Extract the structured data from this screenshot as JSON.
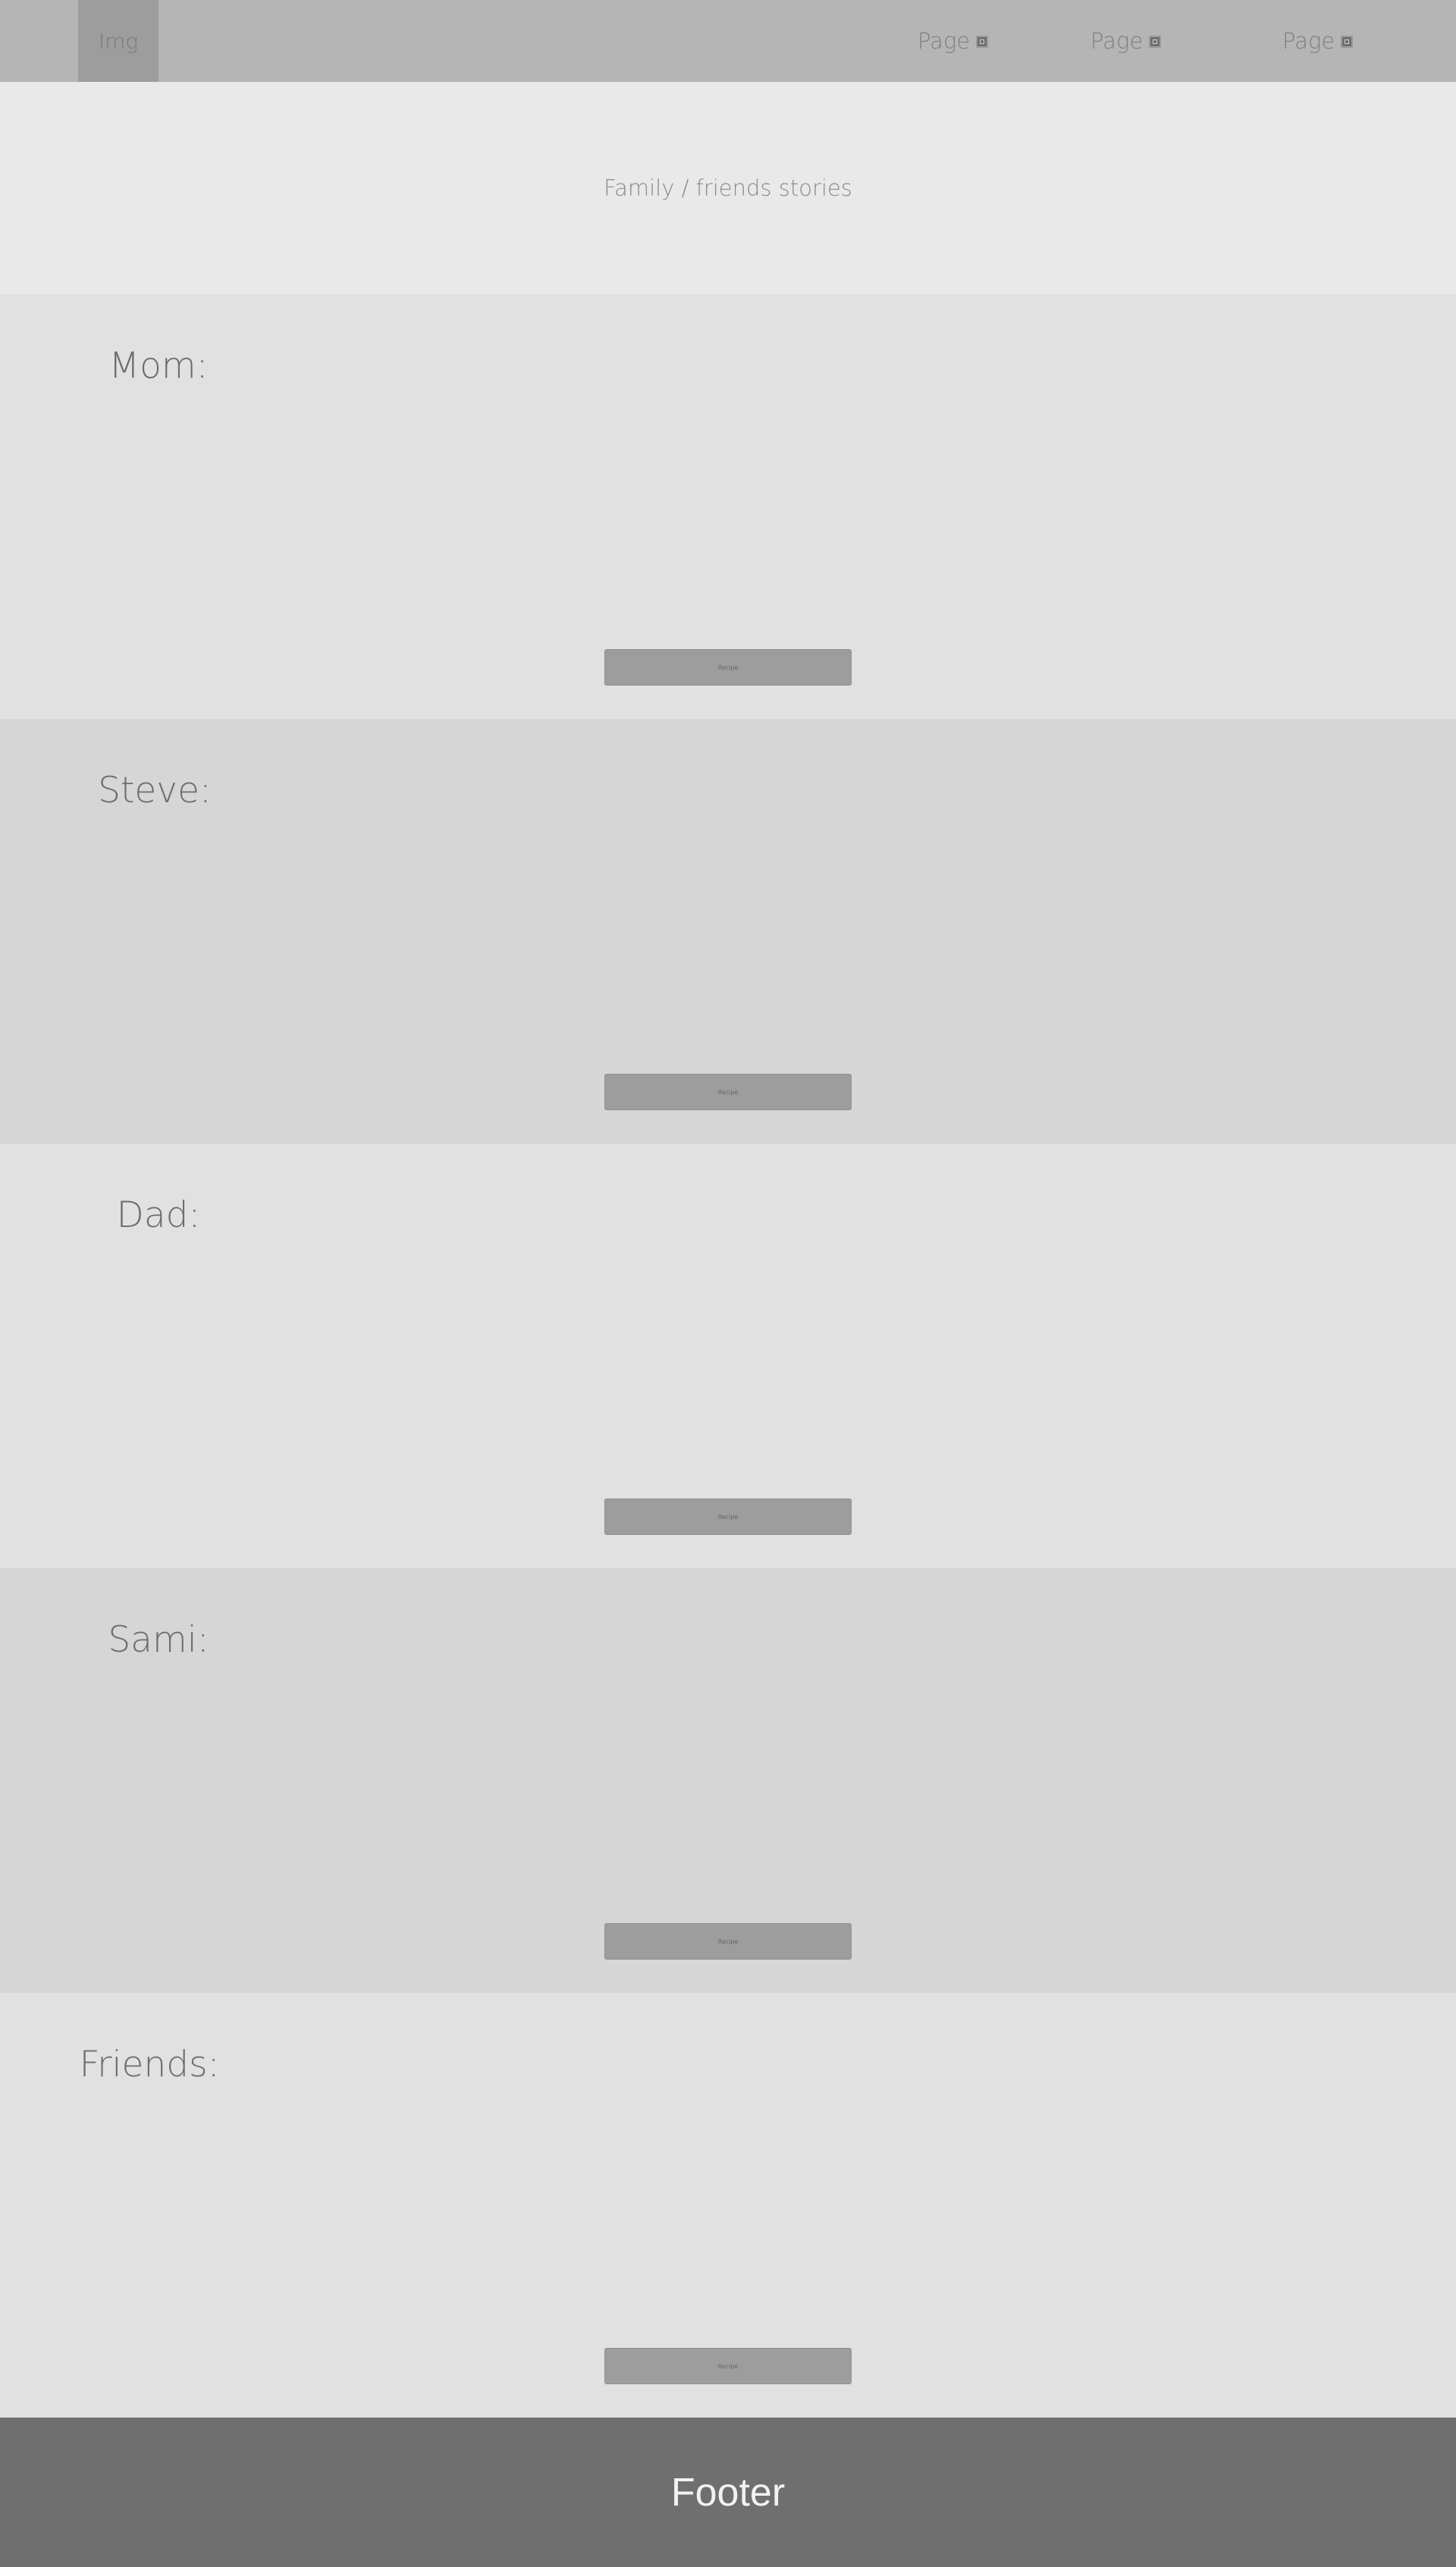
{
  "nav": {
    "logo": "Img",
    "links": [
      {
        "label": "Page",
        "icon": "external-link-icon"
      },
      {
        "label": "Page",
        "icon": "external-link-icon"
      },
      {
        "label": "Page",
        "icon": "external-link-icon"
      }
    ]
  },
  "hero": {
    "text": "Family / friends stories"
  },
  "sections": [
    {
      "title": "Mom:",
      "button": "Recipe"
    },
    {
      "title": "Steve:",
      "button": "Recipe"
    },
    {
      "title": "Dad:",
      "button": "Recipe"
    },
    {
      "title": "Sami:",
      "button": "Recipe"
    },
    {
      "title": "Friends:",
      "button": "Recipe"
    }
  ],
  "footer": {
    "text": "Footer"
  }
}
